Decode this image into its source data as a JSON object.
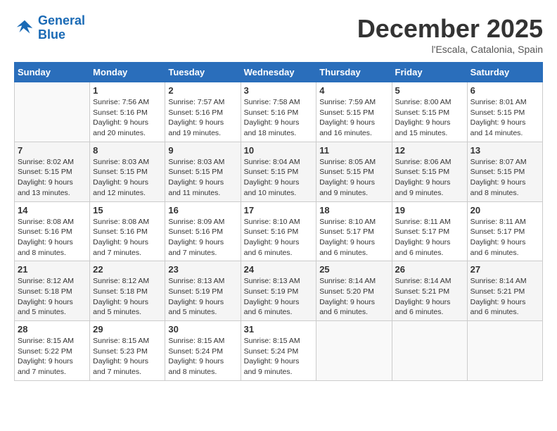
{
  "logo": {
    "line1": "General",
    "line2": "Blue"
  },
  "title": "December 2025",
  "location": "l'Escala, Catalonia, Spain",
  "weekdays": [
    "Sunday",
    "Monday",
    "Tuesday",
    "Wednesday",
    "Thursday",
    "Friday",
    "Saturday"
  ],
  "weeks": [
    [
      {
        "day": "",
        "info": ""
      },
      {
        "day": "1",
        "info": "Sunrise: 7:56 AM\nSunset: 5:16 PM\nDaylight: 9 hours\nand 20 minutes."
      },
      {
        "day": "2",
        "info": "Sunrise: 7:57 AM\nSunset: 5:16 PM\nDaylight: 9 hours\nand 19 minutes."
      },
      {
        "day": "3",
        "info": "Sunrise: 7:58 AM\nSunset: 5:16 PM\nDaylight: 9 hours\nand 18 minutes."
      },
      {
        "day": "4",
        "info": "Sunrise: 7:59 AM\nSunset: 5:15 PM\nDaylight: 9 hours\nand 16 minutes."
      },
      {
        "day": "5",
        "info": "Sunrise: 8:00 AM\nSunset: 5:15 PM\nDaylight: 9 hours\nand 15 minutes."
      },
      {
        "day": "6",
        "info": "Sunrise: 8:01 AM\nSunset: 5:15 PM\nDaylight: 9 hours\nand 14 minutes."
      }
    ],
    [
      {
        "day": "7",
        "info": "Sunrise: 8:02 AM\nSunset: 5:15 PM\nDaylight: 9 hours\nand 13 minutes."
      },
      {
        "day": "8",
        "info": "Sunrise: 8:03 AM\nSunset: 5:15 PM\nDaylight: 9 hours\nand 12 minutes."
      },
      {
        "day": "9",
        "info": "Sunrise: 8:03 AM\nSunset: 5:15 PM\nDaylight: 9 hours\nand 11 minutes."
      },
      {
        "day": "10",
        "info": "Sunrise: 8:04 AM\nSunset: 5:15 PM\nDaylight: 9 hours\nand 10 minutes."
      },
      {
        "day": "11",
        "info": "Sunrise: 8:05 AM\nSunset: 5:15 PM\nDaylight: 9 hours\nand 9 minutes."
      },
      {
        "day": "12",
        "info": "Sunrise: 8:06 AM\nSunset: 5:15 PM\nDaylight: 9 hours\nand 9 minutes."
      },
      {
        "day": "13",
        "info": "Sunrise: 8:07 AM\nSunset: 5:15 PM\nDaylight: 9 hours\nand 8 minutes."
      }
    ],
    [
      {
        "day": "14",
        "info": "Sunrise: 8:08 AM\nSunset: 5:16 PM\nDaylight: 9 hours\nand 8 minutes."
      },
      {
        "day": "15",
        "info": "Sunrise: 8:08 AM\nSunset: 5:16 PM\nDaylight: 9 hours\nand 7 minutes."
      },
      {
        "day": "16",
        "info": "Sunrise: 8:09 AM\nSunset: 5:16 PM\nDaylight: 9 hours\nand 7 minutes."
      },
      {
        "day": "17",
        "info": "Sunrise: 8:10 AM\nSunset: 5:16 PM\nDaylight: 9 hours\nand 6 minutes."
      },
      {
        "day": "18",
        "info": "Sunrise: 8:10 AM\nSunset: 5:17 PM\nDaylight: 9 hours\nand 6 minutes."
      },
      {
        "day": "19",
        "info": "Sunrise: 8:11 AM\nSunset: 5:17 PM\nDaylight: 9 hours\nand 6 minutes."
      },
      {
        "day": "20",
        "info": "Sunrise: 8:11 AM\nSunset: 5:17 PM\nDaylight: 9 hours\nand 6 minutes."
      }
    ],
    [
      {
        "day": "21",
        "info": "Sunrise: 8:12 AM\nSunset: 5:18 PM\nDaylight: 9 hours\nand 5 minutes."
      },
      {
        "day": "22",
        "info": "Sunrise: 8:12 AM\nSunset: 5:18 PM\nDaylight: 9 hours\nand 5 minutes."
      },
      {
        "day": "23",
        "info": "Sunrise: 8:13 AM\nSunset: 5:19 PM\nDaylight: 9 hours\nand 5 minutes."
      },
      {
        "day": "24",
        "info": "Sunrise: 8:13 AM\nSunset: 5:19 PM\nDaylight: 9 hours\nand 6 minutes."
      },
      {
        "day": "25",
        "info": "Sunrise: 8:14 AM\nSunset: 5:20 PM\nDaylight: 9 hours\nand 6 minutes."
      },
      {
        "day": "26",
        "info": "Sunrise: 8:14 AM\nSunset: 5:21 PM\nDaylight: 9 hours\nand 6 minutes."
      },
      {
        "day": "27",
        "info": "Sunrise: 8:14 AM\nSunset: 5:21 PM\nDaylight: 9 hours\nand 6 minutes."
      }
    ],
    [
      {
        "day": "28",
        "info": "Sunrise: 8:15 AM\nSunset: 5:22 PM\nDaylight: 9 hours\nand 7 minutes."
      },
      {
        "day": "29",
        "info": "Sunrise: 8:15 AM\nSunset: 5:23 PM\nDaylight: 9 hours\nand 7 minutes."
      },
      {
        "day": "30",
        "info": "Sunrise: 8:15 AM\nSunset: 5:24 PM\nDaylight: 9 hours\nand 8 minutes."
      },
      {
        "day": "31",
        "info": "Sunrise: 8:15 AM\nSunset: 5:24 PM\nDaylight: 9 hours\nand 9 minutes."
      },
      {
        "day": "",
        "info": ""
      },
      {
        "day": "",
        "info": ""
      },
      {
        "day": "",
        "info": ""
      }
    ]
  ]
}
